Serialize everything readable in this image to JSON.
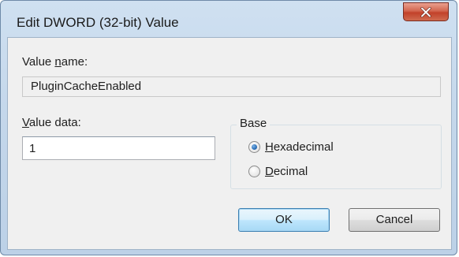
{
  "window": {
    "title": "Edit DWORD (32-bit) Value"
  },
  "fields": {
    "value_name_label_pre": "Value ",
    "value_name_label_key": "n",
    "value_name_label_post": "ame:",
    "value_name": "PluginCacheEnabled",
    "value_data_label_key": "V",
    "value_data_label_post": "alue data:",
    "value_data": "1"
  },
  "base": {
    "legend": "Base",
    "options": [
      {
        "key": "H",
        "rest": "exadecimal",
        "selected": true
      },
      {
        "key": "D",
        "rest": "ecimal",
        "selected": false
      }
    ]
  },
  "buttons": {
    "ok": "OK",
    "cancel": "Cancel"
  },
  "colors": {
    "title_bar": "#c3d6ea",
    "close_button": "#c2412a",
    "dialog_background": "#f0f0f0",
    "default_button_border": "#3c7fb1"
  },
  "icons": {
    "close": "close-icon"
  }
}
